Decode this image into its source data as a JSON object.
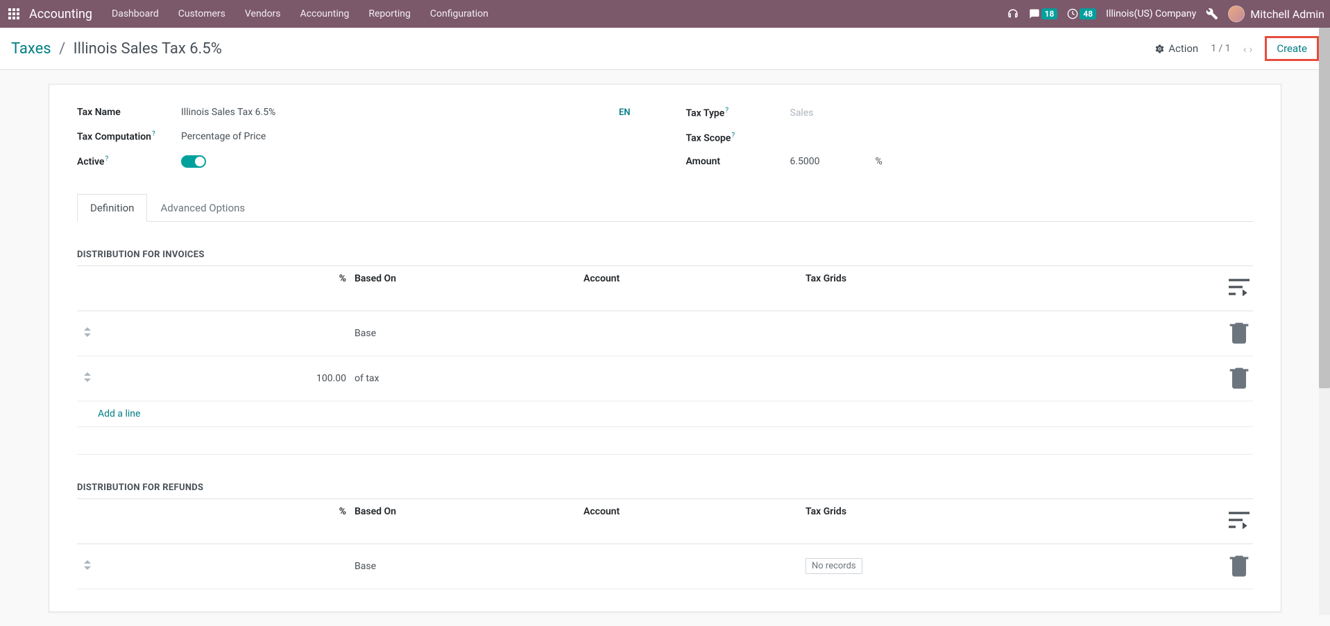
{
  "nav": {
    "app_name": "Accounting",
    "menu": [
      "Dashboard",
      "Customers",
      "Vendors",
      "Accounting",
      "Reporting",
      "Configuration"
    ],
    "messages_badge": "18",
    "activities_badge": "48",
    "company": "Illinois(US) Company",
    "user_name": "Mitchell Admin"
  },
  "control": {
    "breadcrumb_parent": "Taxes",
    "breadcrumb_current": "Illinois Sales Tax 6.5%",
    "action_label": "Action",
    "pager": "1 / 1",
    "create_label": "Create"
  },
  "form": {
    "tax_name_label": "Tax Name",
    "tax_name_value": "Illinois Sales Tax 6.5%",
    "lang_code": "EN",
    "tax_computation_label": "Tax Computation",
    "tax_computation_value": "Percentage of Price",
    "active_label": "Active",
    "tax_type_label": "Tax Type",
    "tax_type_value": "Sales",
    "tax_scope_label": "Tax Scope",
    "tax_scope_value": "",
    "amount_label": "Amount",
    "amount_value": "6.5000",
    "amount_unit": "%"
  },
  "tabs": {
    "definition": "Definition",
    "advanced": "Advanced Options"
  },
  "sections": {
    "invoices_title": "DISTRIBUTION FOR INVOICES",
    "refunds_title": "DISTRIBUTION FOR REFUNDS"
  },
  "table": {
    "col_percent": "%",
    "col_based": "Based On",
    "col_account": "Account",
    "col_grids": "Tax Grids",
    "add_line": "Add a line",
    "no_records": "No records"
  },
  "invoice_rows": [
    {
      "percent": "",
      "based": "Base"
    },
    {
      "percent": "100.00",
      "based": "of tax"
    }
  ],
  "refund_rows": [
    {
      "percent": "",
      "based": "Base"
    }
  ]
}
